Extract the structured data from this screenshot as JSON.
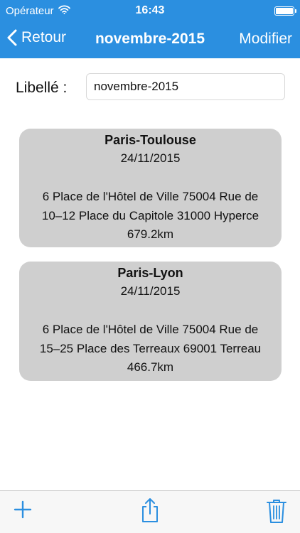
{
  "status_bar": {
    "carrier": "Opérateur",
    "time": "16:43"
  },
  "nav_bar": {
    "back_label": "Retour",
    "title": "novembre-2015",
    "edit_label": "Modifier"
  },
  "form": {
    "label": "Libellé :",
    "value": "novembre-2015"
  },
  "trips": [
    {
      "title": "Paris-Toulouse",
      "date": "24/11/2015",
      "address_line_1": "6 Place de l'Hôtel de Ville 75004 Rue de",
      "address_line_2": "10–12 Place du Capitole 31000 Hyperce",
      "distance": "679.2km"
    },
    {
      "title": "Paris-Lyon",
      "date": "24/11/2015",
      "address_line_1": "6 Place de l'Hôtel de Ville 75004 Rue de",
      "address_line_2": "15–25 Place des Terreaux 69001 Terreau",
      "distance": "466.7km"
    }
  ],
  "toolbar": {
    "icons": [
      "plus-icon",
      "share-icon",
      "trash-icon"
    ]
  },
  "colors": {
    "accent": "#2b8fe0",
    "card_background": "#cfcfcf",
    "toolbar_background": "#f7f7f7"
  }
}
